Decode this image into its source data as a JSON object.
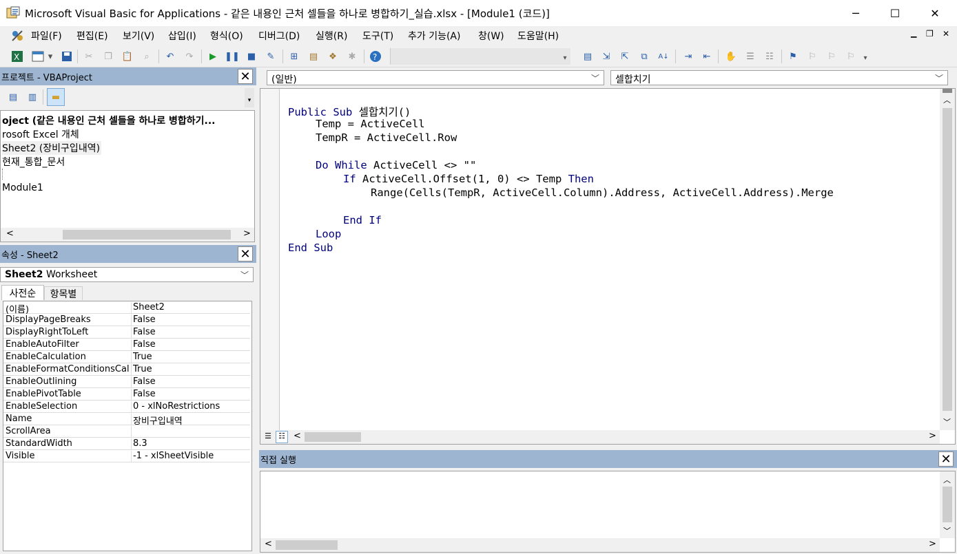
{
  "window": {
    "title": "Microsoft Visual Basic for Applications - 같은 내용인 근처 셀들을 하나로 병합하기_실습.xlsx - [Module1 (코드)]",
    "minimize": "─",
    "maximize": "☐",
    "close": "✕"
  },
  "menu": {
    "items": [
      "파일(F)",
      "편집(E)",
      "보기(V)",
      "삽입(I)",
      "형식(O)",
      "디버그(D)",
      "실행(R)",
      "도구(T)",
      "추가 기능(A)",
      "창(W)",
      "도움말(H)"
    ],
    "doc_min": "▁",
    "doc_restore": "❐",
    "doc_close": "✕"
  },
  "project": {
    "header": "프로젝트 - VBAProject",
    "close": "✕",
    "tree": [
      "oject (같은 내용인 근처 셀들을 하나로 병합하기...",
      "rosoft Excel 개체",
      "Sheet2 (장비구입내역)",
      "현재_통합_문서",
      "",
      "Module1"
    ]
  },
  "properties": {
    "header": "속성 - Sheet2",
    "close": "✕",
    "object_name": "Sheet2",
    "object_type": "Worksheet",
    "tabs": [
      "사전순",
      "항목별"
    ],
    "rows": [
      {
        "k": "(이름)",
        "v": "Sheet2"
      },
      {
        "k": "DisplayPageBreaks",
        "v": "False"
      },
      {
        "k": "DisplayRightToLeft",
        "v": "False"
      },
      {
        "k": "EnableAutoFilter",
        "v": "False"
      },
      {
        "k": "EnableCalculation",
        "v": "True"
      },
      {
        "k": "EnableFormatConditionsCal",
        "v": "True"
      },
      {
        "k": "EnableOutlining",
        "v": "False"
      },
      {
        "k": "EnablePivotTable",
        "v": "False"
      },
      {
        "k": "EnableSelection",
        "v": "0 - xlNoRestrictions"
      },
      {
        "k": "Name",
        "v": "장비구입내역"
      },
      {
        "k": "ScrollArea",
        "v": ""
      },
      {
        "k": "StandardWidth",
        "v": "8.3"
      },
      {
        "k": "Visible",
        "v": "-1 - xlSheetVisible"
      }
    ]
  },
  "code": {
    "object_combo": "(일반)",
    "proc_combo": "셀합치기",
    "lines": [
      {
        "indent": 0,
        "parts": [
          {
            "t": "Public Sub",
            "kw": true
          },
          {
            "t": " 셀합치기()",
            "kw": false
          }
        ]
      },
      {
        "indent": 1,
        "parts": [
          {
            "t": "Temp = ActiveCell",
            "kw": false
          }
        ]
      },
      {
        "indent": 1,
        "parts": [
          {
            "t": "TempR = ActiveCell.Row",
            "kw": false
          }
        ]
      },
      {
        "indent": 0,
        "parts": []
      },
      {
        "indent": 1,
        "parts": [
          {
            "t": "Do While",
            "kw": true
          },
          {
            "t": " ActiveCell <> \"\"",
            "kw": false
          }
        ]
      },
      {
        "indent": 2,
        "parts": [
          {
            "t": "If",
            "kw": true
          },
          {
            "t": " ActiveCell.Offset(1, 0) <> Temp ",
            "kw": false
          },
          {
            "t": "Then",
            "kw": true
          }
        ]
      },
      {
        "indent": 3,
        "parts": [
          {
            "t": "Range(Cells(TempR, ActiveCell.Column).Address, ActiveCell.Address).Merge",
            "kw": false
          }
        ]
      },
      {
        "indent": 0,
        "parts": []
      },
      {
        "indent": 2,
        "parts": [
          {
            "t": "End If",
            "kw": true
          }
        ]
      },
      {
        "indent": 1,
        "parts": [
          {
            "t": "Loop",
            "kw": true
          }
        ]
      },
      {
        "indent": 0,
        "parts": [
          {
            "t": "End Sub",
            "kw": true
          }
        ]
      }
    ]
  },
  "immediate": {
    "header": "직접 실행",
    "close": "✕"
  },
  "colors": {
    "pane_header": "#9db5d0",
    "keyword": "#00007f"
  }
}
